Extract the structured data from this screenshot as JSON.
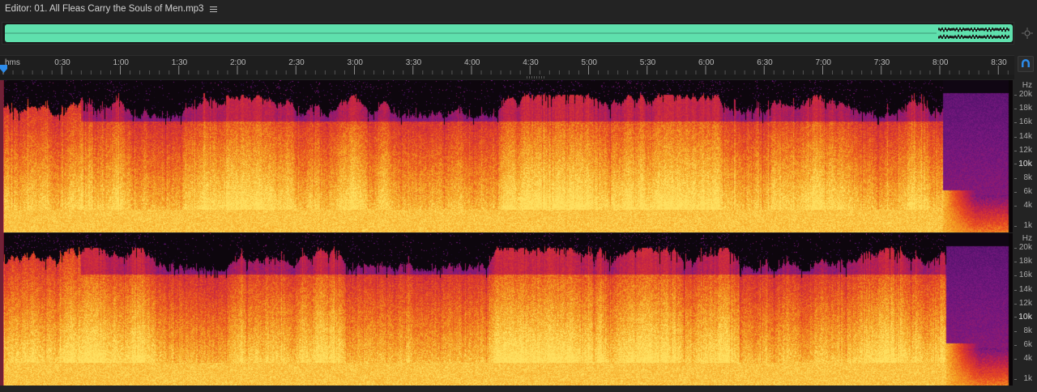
{
  "editor": {
    "title": "Editor: 01. All Fleas Carry the Souls of Men.mp3",
    "menu_icon": "hamburger-menu-icon"
  },
  "overview": {
    "waveform_color": "#5fe0ad",
    "zoom_icon": "zoom-navigator-icon"
  },
  "timeline": {
    "unit_label": "hms",
    "ticks": [
      "0:30",
      "1:00",
      "1:30",
      "2:00",
      "2:30",
      "3:00",
      "3:30",
      "4:00",
      "4:30",
      "5:00",
      "5:30",
      "6:00",
      "6:30",
      "7:00",
      "7:30",
      "8:00",
      "8:30"
    ],
    "snap_icon": "magnet-snap-icon"
  },
  "spectral": {
    "unit": "Hz",
    "frequency_labels": [
      "20k",
      "18k",
      "16k",
      "14k",
      "12k",
      "10k",
      "8k",
      "6k",
      "4k",
      "1k"
    ],
    "emphasized_label": "10k",
    "channels": [
      "left",
      "right"
    ],
    "colormap": [
      "#0a0508",
      "#3c1060",
      "#7a1880",
      "#c0204a",
      "#e84820",
      "#f5a020",
      "#ffe060"
    ]
  }
}
